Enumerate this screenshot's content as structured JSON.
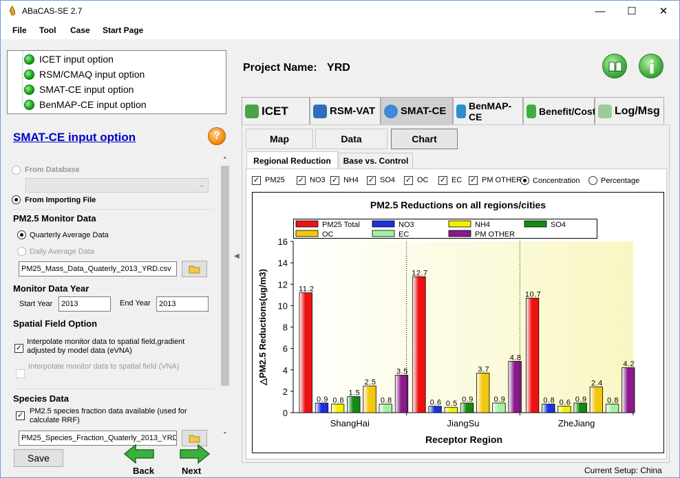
{
  "app": {
    "title": "ABaCAS-SE 2.7",
    "window_controls": {
      "minimize": "—",
      "maximize": "☐",
      "close": "✕"
    }
  },
  "menu": [
    "File",
    "Tool",
    "Case",
    "Start Page"
  ],
  "tree": [
    "ICET input option",
    "RSM/CMAQ input option",
    "SMAT-CE input option",
    "BenMAP-CE input option"
  ],
  "left": {
    "section_title": "SMAT-CE input option",
    "help": "?",
    "from_database": "From Database",
    "from_importing": "From Importing File",
    "pm_monitor_header": "PM2.5 Monitor Data",
    "quarterly": "Quarterly Average Data",
    "daily": "Daily Average Data",
    "file_path": "PM25_Mass_Data_Quaterly_2013_YRD.csv",
    "monitor_year_header": "Monitor Data Year",
    "start_year_label": "Start Year",
    "start_year": "2013",
    "end_year_label": "End Year",
    "end_year": "2013",
    "spatial_header": "Spatial Field Option",
    "evna_label": "Interpolate monitor data to spatial field,gradient adjusted by model data (eVNA)",
    "vna_label": "Interpolate monitor data to spatial field (VNA)",
    "species_header": "Species Data",
    "species_label": "PM2.5 species fraction data available (used for calculate RRF)",
    "species_file": "PM25_Species_Fraction_Quaterly_2013_YRD.csv",
    "save": "Save",
    "back": "Back",
    "next": "Next"
  },
  "project": {
    "label": "Project Name:",
    "name": "YRD"
  },
  "main_tabs": [
    "ICET",
    "RSM-VAT",
    "SMAT-CE",
    "BenMAP-CE",
    "Benefit/Cost",
    "Log/Msg"
  ],
  "sub_tabs": [
    "Map",
    "Data",
    "Chart"
  ],
  "chart_tabs": [
    "Regional Reduction",
    "Base vs. Control"
  ],
  "species_checks": [
    "PM25",
    "NO3",
    "NH4",
    "SO4",
    "OC",
    "EC",
    "PM OTHER"
  ],
  "mode_radios": [
    "Concentration",
    "Percentage"
  ],
  "status": "Current Setup: China",
  "chart_data": {
    "type": "bar",
    "title": "PM2.5 Reductions on all regions/cities",
    "xlabel": "Receptor Region",
    "ylabel": "△PM2.5 Reductions(ug/m3)",
    "ylim": [
      0,
      16
    ],
    "yticks": [
      0,
      2,
      4,
      6,
      8,
      10,
      12,
      14,
      16
    ],
    "categories": [
      "ShangHai",
      "JiangSu",
      "ZheJiang"
    ],
    "legend_position": "top",
    "grid": false,
    "series": [
      {
        "name": "PM25 Total",
        "color": "#ee1111",
        "values": [
          11.2,
          12.7,
          10.7
        ]
      },
      {
        "name": "NO3",
        "color": "#1a33dd",
        "values": [
          0.9,
          0.6,
          0.8
        ]
      },
      {
        "name": "NH4",
        "color": "#f2f000",
        "values": [
          0.8,
          0.5,
          0.6
        ]
      },
      {
        "name": "SO4",
        "color": "#138a13",
        "values": [
          1.5,
          0.9,
          0.9
        ]
      },
      {
        "name": "OC",
        "color": "#f2c70f",
        "values": [
          2.5,
          3.7,
          2.4
        ]
      },
      {
        "name": "EC",
        "color": "#a4f0a4",
        "values": [
          0.8,
          0.9,
          0.8
        ]
      },
      {
        "name": "PM OTHER",
        "color": "#8a1b8a",
        "values": [
          3.5,
          4.8,
          4.2
        ]
      }
    ]
  }
}
